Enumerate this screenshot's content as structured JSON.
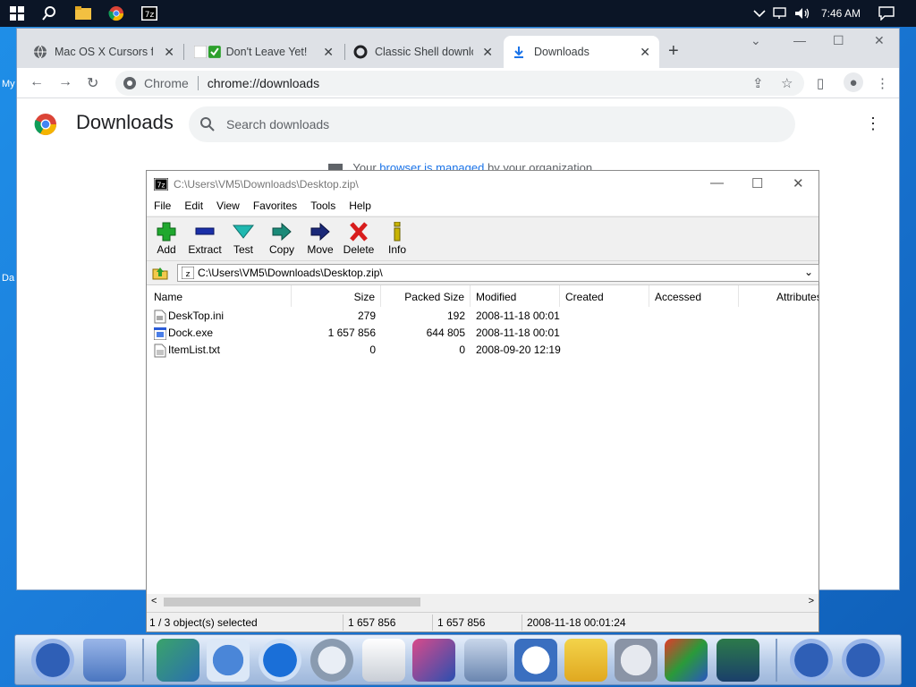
{
  "taskbar": {
    "icons": [
      "windows-start-icon",
      "search-icon",
      "file-explorer-icon",
      "chrome-icon",
      "7zip-icon"
    ],
    "tray_icons": [
      "chevron-up-icon",
      "network-icon",
      "volume-icon"
    ],
    "clock": "7:46 AM",
    "notification_icon": "notification-icon"
  },
  "desktop": {
    "labels": [
      "My",
      "Da"
    ]
  },
  "chrome": {
    "tabs": [
      {
        "title": "Mac OS X Cursors for",
        "icon": "globe-icon",
        "active": false
      },
      {
        "title": "Don't Leave Yet!",
        "icon": "check-box-icon",
        "active": false
      },
      {
        "title": "Classic Shell downlo",
        "icon": "circle-logo-icon",
        "active": false
      },
      {
        "title": "Downloads",
        "icon": "download-icon",
        "active": true
      }
    ],
    "new_tab_label": "+",
    "omnibox": {
      "site_chip": "Chrome",
      "url": "chrome://downloads"
    },
    "downloads_page": {
      "title": "Downloads",
      "search_placeholder": "Search downloads",
      "managed_prefix": "Your",
      "managed_link": "browser is managed",
      "managed_suffix": "by your organization"
    }
  },
  "sevenzip": {
    "window_title": "C:\\Users\\VM5\\Downloads\\Desktop.zip\\",
    "menu": [
      "File",
      "Edit",
      "View",
      "Favorites",
      "Tools",
      "Help"
    ],
    "toolbar": [
      {
        "label": "Add",
        "icon": "add-icon",
        "color": "#1fa82e"
      },
      {
        "label": "Extract",
        "icon": "extract-icon",
        "color": "#1a2fa8"
      },
      {
        "label": "Test",
        "icon": "test-icon",
        "color": "#1fb8b0"
      },
      {
        "label": "Copy",
        "icon": "copy-icon",
        "color": "#1a8a78"
      },
      {
        "label": "Move",
        "icon": "move-icon",
        "color": "#1a2878"
      },
      {
        "label": "Delete",
        "icon": "delete-icon",
        "color": "#d81c1c"
      },
      {
        "label": "Info",
        "icon": "info-icon",
        "color": "#c8b400"
      }
    ],
    "address": "C:\\Users\\VM5\\Downloads\\Desktop.zip\\",
    "columns": [
      "Name",
      "Size",
      "Packed Size",
      "Modified",
      "Created",
      "Accessed",
      "Attributes"
    ],
    "rows": [
      {
        "name": "DeskTop.ini",
        "size": "279",
        "packed": "192",
        "modified": "2008-11-18 00:01",
        "icon": "ini-file-icon"
      },
      {
        "name": "Dock.exe",
        "size": "1 657 856",
        "packed": "644 805",
        "modified": "2008-11-18 00:01",
        "icon": "exe-file-icon"
      },
      {
        "name": "ItemList.txt",
        "size": "0",
        "packed": "0",
        "modified": "2008-09-20 12:19",
        "icon": "txt-file-icon"
      }
    ],
    "status": {
      "selected": "1 / 3 object(s) selected",
      "size": "1 657 856",
      "packed": "1 657 856",
      "modified": "2008-11-18 00:01:24"
    }
  },
  "dock": {
    "items": [
      "key-icon",
      "trash-icon",
      "network-computer-icon",
      "mail-icon",
      "internet-explorer-icon",
      "search-magnifier-icon",
      "rtf-document-icon",
      "cube-app-icon",
      "hard-drive-icon",
      "folder-clock-icon",
      "hexagon-app-icon",
      "cd-discs-icon",
      "media-player-icon",
      "paint-display-icon",
      "power-icon",
      "shutdown-icon"
    ]
  }
}
